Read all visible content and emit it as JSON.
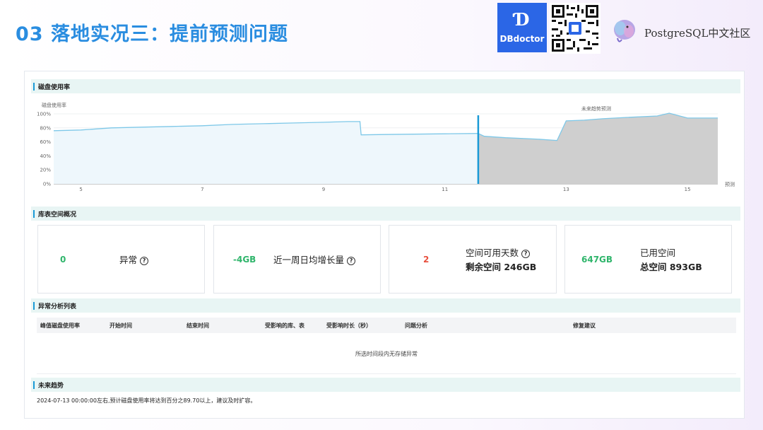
{
  "slide": {
    "title": "03 落地实况三：提前预测问题"
  },
  "brand": {
    "dbdoctor_label": "DBdoctor",
    "pg_community": "PostgreSQL中文社区"
  },
  "sections": {
    "disk_usage": "磁盘使用率",
    "space_overview": "库表空间概况",
    "anomaly_list": "异常分析列表",
    "future_trend": "未来趋势"
  },
  "cards": [
    {
      "value": "0",
      "label": "异常",
      "has_help": true,
      "value_color": "#2fb56b"
    },
    {
      "value": "-4GB",
      "label": "近一周日均增长量",
      "has_help": true,
      "value_color": "#2fb56b"
    },
    {
      "value": "2",
      "label": "空间可用天数",
      "label2": "剩余空间 246GB",
      "has_help": true,
      "value_color": "#e8503e"
    },
    {
      "value": "647GB",
      "label": "已用空间",
      "label2": "总空间 893GB",
      "has_help": false,
      "value_color": "#2fb56b"
    }
  ],
  "table": {
    "columns": [
      "峰值磁盘使用率",
      "开始时间",
      "结束时间",
      "受影响的库、表",
      "受影响时长（秒）",
      "问题分析",
      "修复建议"
    ],
    "empty_message": "所选时间段内无存储异常"
  },
  "future_trend_text": "2024-07-13 00:00:00左右,预计磁盘使用率将达到百分之89.70以上，建议及时扩容。",
  "chart_data": {
    "type": "area",
    "ylabel": "磁盘使用率",
    "y_ticks": [
      "0%",
      "20%",
      "40%",
      "60%",
      "80%",
      "100%"
    ],
    "x_ticks": [
      "5",
      "7",
      "9",
      "11",
      "13",
      "15"
    ],
    "x_tick_values": [
      5,
      7,
      9,
      11,
      13,
      15
    ],
    "xlim": [
      4.55,
      15.5
    ],
    "ylim": [
      0,
      100
    ],
    "x_axis_end_label": "预测",
    "forecast_label": "未来趋势预测",
    "forecast_start": 11.55,
    "colors": {
      "history_line": "#7ec8e8",
      "history_fill": "#eef7fc",
      "forecast_fill": "#cfcfcf",
      "divider": "#1a9ad6"
    },
    "series": [
      {
        "name": "history",
        "x": [
          4.55,
          5.0,
          5.5,
          6.0,
          6.5,
          7.0,
          7.5,
          8.0,
          8.5,
          9.0,
          9.4,
          9.6,
          9.62,
          10.0,
          10.5,
          11.0,
          11.55
        ],
        "y": [
          76,
          77,
          80,
          81,
          82,
          83,
          85,
          86,
          87,
          88,
          89,
          89,
          70,
          70.5,
          71,
          71.5,
          72
        ]
      },
      {
        "name": "forecast",
        "x": [
          11.55,
          11.65,
          12.0,
          12.5,
          12.85,
          13.0,
          13.3,
          13.6,
          14.0,
          14.5,
          14.7,
          15.0,
          15.5
        ],
        "y": [
          72,
          68,
          66,
          64,
          62,
          90,
          91,
          93,
          95,
          97,
          101,
          94,
          94
        ]
      }
    ]
  }
}
